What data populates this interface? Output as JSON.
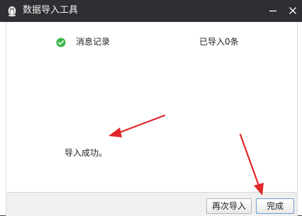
{
  "window": {
    "title": "数据导入工具",
    "app_icon": "penguin-icon",
    "minimize_icon": "minimize-icon",
    "close_icon": "close-icon"
  },
  "import_item": {
    "label": "消息记录",
    "count_text": "已导入0条",
    "status_icon": "check-circle-icon",
    "status_color": "#3cb54a"
  },
  "result": {
    "message": "导入成功。"
  },
  "buttons": {
    "reimport_label": "再次导入",
    "finish_label": "完成"
  },
  "colors": {
    "titlebar": "#2f2f33",
    "annotation_arrow": "#e0262b"
  }
}
